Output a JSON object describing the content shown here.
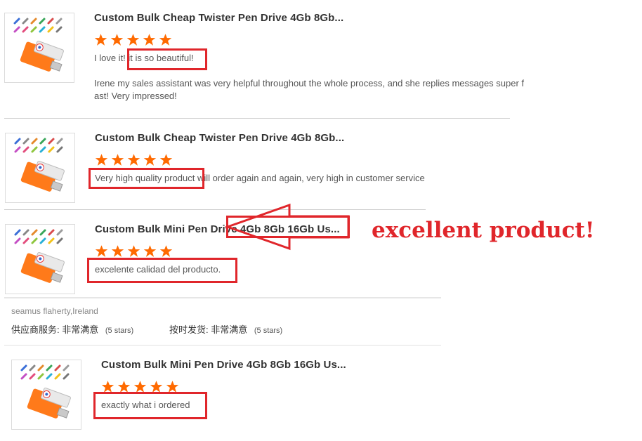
{
  "reviews": [
    {
      "product_title": "Custom Bulk Cheap Twister Pen Drive 4Gb 8Gb...",
      "review_prefix": "I love it!",
      "review_highlight": " it is so beautiful!",
      "review_extra": "Irene my sales assistant was very helpful throughout the whole process, and she replies messages super f",
      "review_extra2": "ast! Very impressed!"
    },
    {
      "product_title": "Custom Bulk Cheap Twister Pen Drive 4Gb 8Gb...",
      "review_highlight": "Very high quality product",
      "review_rest": " will order again and again, very high in customer service"
    },
    {
      "product_title": "Custom Bulk Mini Pen Drive 4Gb 8Gb 16Gb Us...",
      "review_highlight": "excelente calidad del producto."
    },
    {
      "product_title": "Custom Bulk Mini Pen Drive 4Gb 8Gb 16Gb Us...",
      "review_highlight": "exactly what i ordered"
    }
  ],
  "rating_stars": 5,
  "reviewer": "seamus flaherty,Ireland",
  "supplier_service_label": "供应商服务: 非常满意",
  "supplier_service_value": "(5 stars)",
  "on_time_label": "按时发货: 非常满意",
  "on_time_value": "(5 stars)",
  "annotation": "excellent product!",
  "colors": {
    "star": "#ff6a00",
    "highlight_box": "#e0262b",
    "annotation": "#e0262b"
  },
  "icons": [
    "usb-drive-thumbnail-icon",
    "star-icon",
    "arrow-left-icon"
  ]
}
